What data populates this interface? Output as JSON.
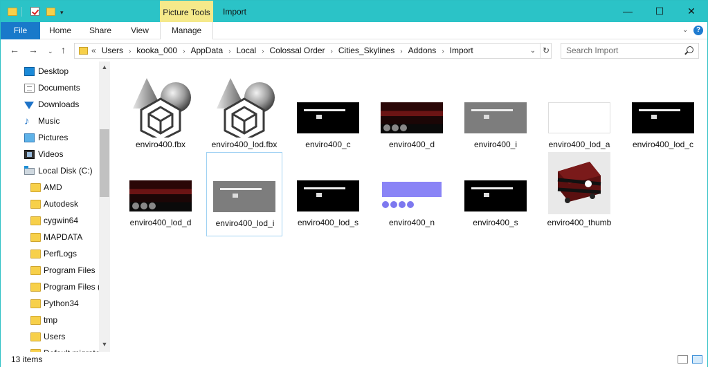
{
  "titlebar": {
    "contextual_tab": "Picture Tools",
    "title": "Import",
    "minimize": "—",
    "maximize": "☐",
    "close": "✕"
  },
  "ribbon": {
    "tabs": [
      "File",
      "Home",
      "Share",
      "View",
      "Manage"
    ]
  },
  "address": {
    "overflow": "«",
    "crumbs": [
      "Users",
      "kooka_000",
      "AppData",
      "Local",
      "Colossal Order",
      "Cities_Skylines",
      "Addons",
      "Import"
    ],
    "search_placeholder": "Search Import"
  },
  "nav": {
    "items": [
      {
        "label": "Desktop",
        "icon": "desktop-icon"
      },
      {
        "label": "Documents",
        "icon": "documents-icon"
      },
      {
        "label": "Downloads",
        "icon": "downloads-icon"
      },
      {
        "label": "Music",
        "icon": "music-icon"
      },
      {
        "label": "Pictures",
        "icon": "pictures-icon"
      },
      {
        "label": "Videos",
        "icon": "videos-icon"
      },
      {
        "label": "Local Disk (C:)",
        "icon": "disk-icon"
      },
      {
        "label": "AMD",
        "icon": "folder-icon"
      },
      {
        "label": "Autodesk",
        "icon": "folder-icon"
      },
      {
        "label": "cygwin64",
        "icon": "folder-icon"
      },
      {
        "label": "MAPDATA",
        "icon": "folder-icon"
      },
      {
        "label": "PerfLogs",
        "icon": "folder-icon"
      },
      {
        "label": "Program Files",
        "icon": "folder-icon"
      },
      {
        "label": "Program Files (",
        "icon": "folder-icon"
      },
      {
        "label": "Python34",
        "icon": "folder-icon"
      },
      {
        "label": "tmp",
        "icon": "folder-icon"
      },
      {
        "label": "Users",
        "icon": "folder-icon"
      },
      {
        "label": "Default.migrated",
        "icon": "folder-icon"
      }
    ]
  },
  "files": [
    {
      "name": "enviro400.fbx",
      "kind": "fbx"
    },
    {
      "name": "enviro400_lod.fbx",
      "kind": "fbx"
    },
    {
      "name": "enviro400_c",
      "kind": "black"
    },
    {
      "name": "enviro400_d",
      "kind": "bus"
    },
    {
      "name": "enviro400_i",
      "kind": "gray"
    },
    {
      "name": "enviro400_lod_a",
      "kind": "white"
    },
    {
      "name": "enviro400_lod_c",
      "kind": "black"
    },
    {
      "name": "enviro400_lod_d",
      "kind": "bus"
    },
    {
      "name": "enviro400_lod_i",
      "kind": "gray"
    },
    {
      "name": "enviro400_lod_s",
      "kind": "black"
    },
    {
      "name": "enviro400_n",
      "kind": "normal"
    },
    {
      "name": "enviro400_s",
      "kind": "black"
    },
    {
      "name": "enviro400_thumb",
      "kind": "thumb"
    }
  ],
  "colors": {
    "titlebar": "#2bc3c7",
    "file_tab": "#1979ca",
    "picture_tools": "#f5e98a",
    "selection_border": "#9fd1f3"
  },
  "status": {
    "count": "13 items"
  }
}
